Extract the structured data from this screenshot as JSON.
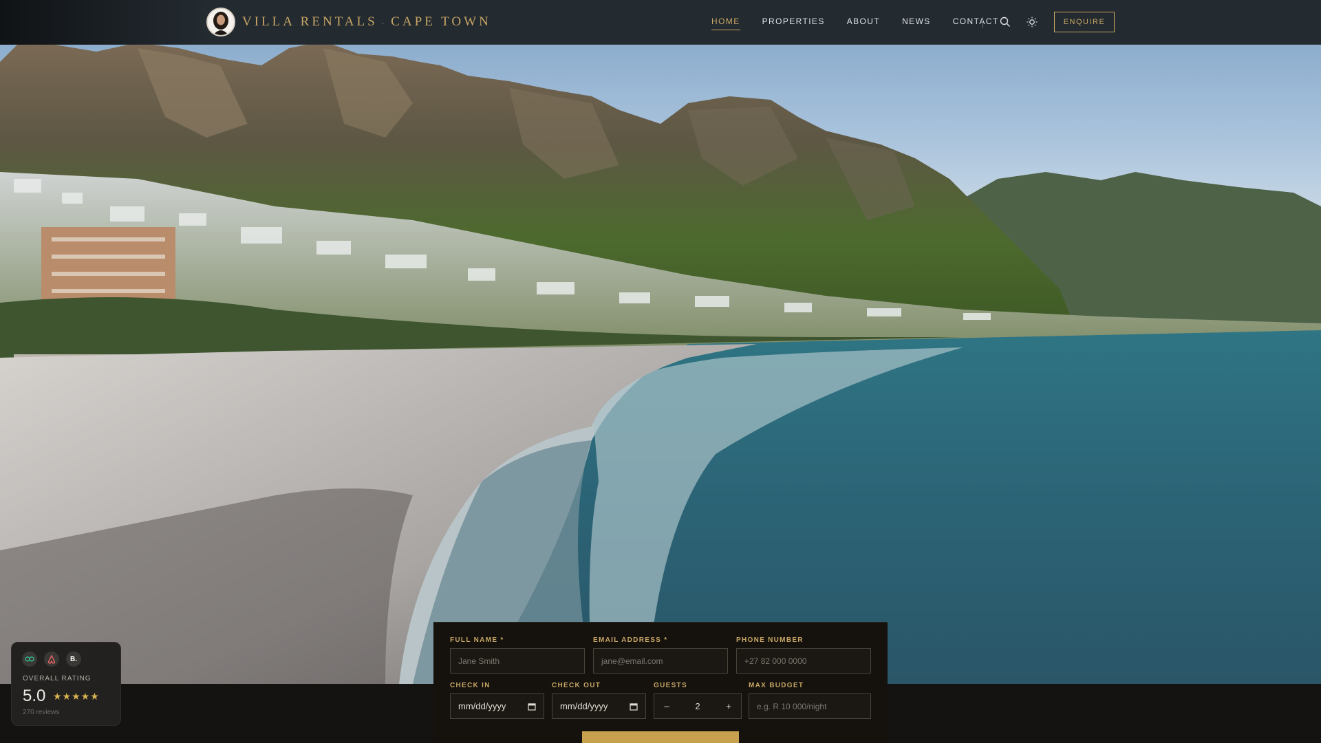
{
  "nav": {
    "brand_part1": "VILLA RENTALS",
    "brand_separator": ".",
    "brand_part2": "CAPE TOWN",
    "items": [
      {
        "label": "HOME",
        "active": true
      },
      {
        "label": "PROPERTIES"
      },
      {
        "label": "ABOUT"
      },
      {
        "label": "NEWS"
      },
      {
        "label": "CONTACT"
      }
    ],
    "search_icon": "search-icon",
    "theme_icon": "sun-icon",
    "enquire_label": "ENQUIRE"
  },
  "form": {
    "full_name_label": "FULL NAME *",
    "full_name_placeholder": "Jane Smith",
    "email_label": "EMAIL ADDRESS *",
    "email_placeholder": "jane@email.com",
    "phone_label": "PHONE NUMBER",
    "phone_placeholder": "+27 82 000 0000",
    "check_in_label": "CHECK IN",
    "check_in_value": "mm/dd/yyyy",
    "check_out_label": "CHECK OUT",
    "check_out_value": "mm/dd/yyyy",
    "guests_label": "GUESTS",
    "guests_minus": "–",
    "guests_value": "2",
    "guests_plus": "+",
    "budget_label": "MAX BUDGET",
    "budget_placeholder": "e.g. R 10 000/night"
  },
  "rating": {
    "logo_b": "B.",
    "label": "OVERALL RATING",
    "score": "5.0",
    "stars": "★★★★★",
    "reviews": "270 reviews"
  },
  "colors": {
    "accent": "#c8a665",
    "nav_bg": "#232a30",
    "form_bg": "#15120e"
  }
}
